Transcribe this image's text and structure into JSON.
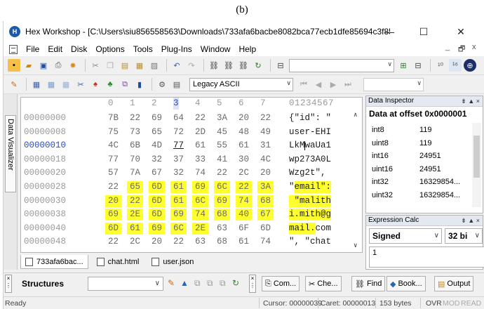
{
  "caption": "(b)",
  "window": {
    "title": "Hex Workshop - [C:\\Users\\siu856558563\\Downloads\\733afa6bacbe8082bca77ecb1dfe85694c3f85d6...",
    "minimize": "—",
    "maximize": "☐",
    "close": "✕",
    "app_icon_glyph": "H"
  },
  "menu": {
    "items": [
      "File",
      "Edit",
      "Disk",
      "Options",
      "Tools",
      "Plug-Ins",
      "Window",
      "Help"
    ],
    "mdi_min": "_",
    "mdi_restore": "🗗",
    "mdi_close": "x"
  },
  "toolbar2": {
    "charset": "Legacy ASCII"
  },
  "data_visualizer_label": "Data Visualizer",
  "hex_view": {
    "header_cols": [
      "0",
      "1",
      "2",
      "3",
      "4",
      "5",
      "6",
      "7"
    ],
    "ascii_header": "01234567",
    "selected_col": 3,
    "highlight_color": "#ffff30",
    "rows": [
      {
        "offset": "00000000",
        "bytes": [
          "7B",
          "22",
          "69",
          "64",
          "22",
          "3A",
          "20",
          "22"
        ],
        "ascii": "{\"id\": \""
      },
      {
        "offset": "00000008",
        "bytes": [
          "75",
          "73",
          "65",
          "72",
          "2D",
          "45",
          "48",
          "49"
        ],
        "ascii": "user-EHI"
      },
      {
        "offset": "00000010",
        "bytes": [
          "4C",
          "6B",
          "4D",
          "77",
          "61",
          "55",
          "61",
          "31"
        ],
        "ascii": "LkMwaUa1"
      },
      {
        "offset": "00000018",
        "bytes": [
          "77",
          "70",
          "32",
          "37",
          "33",
          "41",
          "30",
          "4C"
        ],
        "ascii": "wp273A0L"
      },
      {
        "offset": "00000020",
        "bytes": [
          "57",
          "7A",
          "67",
          "32",
          "74",
          "22",
          "2C",
          "20"
        ],
        "ascii": "Wzg2t\", "
      },
      {
        "offset": "00000028",
        "bytes": [
          "22",
          "65",
          "6D",
          "61",
          "69",
          "6C",
          "22",
          "3A"
        ],
        "ascii": "\"email\":"
      },
      {
        "offset": "00000030",
        "bytes": [
          "20",
          "22",
          "6D",
          "61",
          "6C",
          "69",
          "74",
          "68"
        ],
        "ascii": " \"malith"
      },
      {
        "offset": "00000038",
        "bytes": [
          "69",
          "2E",
          "6D",
          "69",
          "74",
          "68",
          "40",
          "67"
        ],
        "ascii": "i.mith@g"
      },
      {
        "offset": "00000040",
        "bytes": [
          "6D",
          "61",
          "69",
          "6C",
          "2E",
          "63",
          "6F",
          "6D"
        ],
        "ascii": "mail.com"
      },
      {
        "offset": "00000048",
        "bytes": [
          "22",
          "2C",
          "20",
          "22",
          "63",
          "68",
          "61",
          "74"
        ],
        "ascii": "\", \"chat"
      }
    ]
  },
  "file_tabs": [
    "733afa6bac...",
    "chat.html",
    "user.json"
  ],
  "data_inspector": {
    "panel_title": "Data Inspector",
    "heading": "Data at offset 0x0000001",
    "rows": [
      {
        "type": "int8",
        "value": "119"
      },
      {
        "type": "uint8",
        "value": "119"
      },
      {
        "type": "int16",
        "value": "24951"
      },
      {
        "type": "uint16",
        "value": "24951"
      },
      {
        "type": "int32",
        "value": "16329854..."
      },
      {
        "type": "uint32",
        "value": "16329854..."
      }
    ]
  },
  "expression_calc": {
    "panel_title": "Expression Calc",
    "sign": "Signed",
    "width": "32 bi",
    "output": "1"
  },
  "bottom": {
    "structures_label": "Structures",
    "buttons": [
      "Com...",
      "Che...",
      "Find",
      "Book...",
      "Output"
    ]
  },
  "status": {
    "ready": "Ready",
    "cursor": "Cursor: 00000039",
    "caret": "Caret: 00000013",
    "size": "153 bytes",
    "ovr": "OVR",
    "mod": "MOD",
    "read": "READ"
  }
}
